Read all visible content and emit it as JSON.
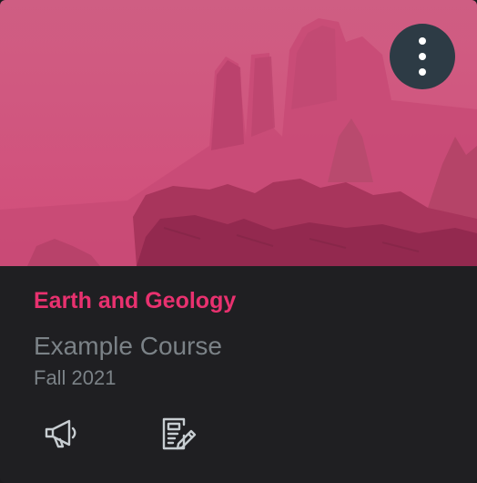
{
  "card": {
    "accent_color": "#e8316f",
    "overlay_color": "#d6366c",
    "options_button_color": "#2d3b45",
    "title": "Earth and Geology",
    "course_code": "Example Course",
    "term": "Fall 2021",
    "options_icon": "kebab-menu-icon",
    "actions": [
      {
        "icon": "megaphone-icon",
        "name": "announcements"
      },
      {
        "icon": "assignment-edit-icon",
        "name": "assignments"
      }
    ]
  }
}
